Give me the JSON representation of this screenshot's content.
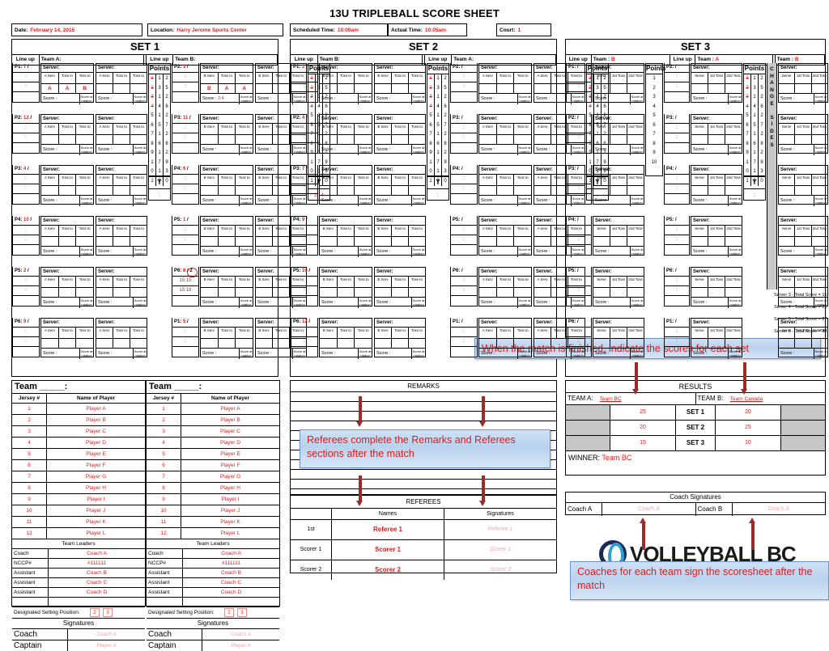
{
  "header": {
    "title": "13U TRIPLEBALL SCORE SHEET",
    "date_label": "Date:",
    "date_value": "February 14, 2015",
    "location_label": "Location:",
    "location_value": "Harry Jerome Sports Center",
    "sched_label": "Scheduled Time:",
    "sched_value": "10:00am",
    "actual_label": "Actual Time:",
    "actual_value": "10:05am",
    "court_label": "Court:",
    "court_value": "1"
  },
  "labels": {
    "lineup": "Line up",
    "server": "Server:",
    "points": "Points",
    "score": "Score  :",
    "score_rot": "Score at rotation",
    "colon": ":",
    "t": "T",
    "slash": "/",
    "team_a_label": "Team A:",
    "team_b_label": "Team B:",
    "team_label": "Team  :",
    "serve_hdr": [
      "A Serv",
      "Toss to",
      "Toss to"
    ],
    "serve_hdr_b": [
      "B Serv",
      "Toss to",
      "Toss to"
    ],
    "serve_hdr_s3": [
      "Serve",
      "1st Toss",
      "2nd Toss"
    ],
    "change_sides": "CHANGE SIDES"
  },
  "points_grid": {
    "col1": [
      "1",
      "2",
      "3",
      "4",
      "5",
      "6",
      "7",
      "8",
      "9",
      "1",
      "0",
      "1"
    ],
    "col2": [
      "1",
      "3",
      "1",
      "4",
      "1",
      "5",
      "1",
      "6",
      "1",
      "7",
      "1",
      "8"
    ],
    "col3": [
      "2",
      "5",
      "2",
      "6",
      "2",
      "7",
      "2",
      "8",
      "2",
      "9",
      "3",
      "0"
    ],
    "struck_col1_rows": [
      0,
      1,
      2,
      3
    ]
  },
  "sets": [
    {
      "title": "SET 1",
      "left": {
        "team_label": "Team A:",
        "serve_hdr": [
          "A Serv",
          "Toss to",
          "Toss to"
        ],
        "lineups": [
          {
            "p": "P1:",
            "num": "7"
          },
          {
            "p": "P2:",
            "num": "12"
          },
          {
            "p": "P3:",
            "num": "4"
          },
          {
            "p": "P4:",
            "num": "10"
          },
          {
            "p": "P5:",
            "num": "2"
          },
          {
            "p": "P6:",
            "num": "9"
          }
        ],
        "serve_marks": [
          "A",
          "A",
          "B"
        ],
        "score_value": ""
      },
      "right": {
        "team_label": "Team B:",
        "serve_hdr": [
          "B Serv",
          "Toss to",
          "Toss to"
        ],
        "lineups": [
          {
            "p": "P2:",
            "num": "3"
          },
          {
            "p": "P3:",
            "num": "11"
          },
          {
            "p": "P4:",
            "num": "6"
          },
          {
            "p": "P5:",
            "num": "1"
          },
          {
            "p": "P6:",
            "num": "8",
            "num2": "2",
            "circled": true,
            "extra": [
              "15:15",
              "15:18"
            ]
          },
          {
            "p": "P1:",
            "num": "5"
          }
        ],
        "serve_marks": [
          "B",
          "A",
          "A"
        ],
        "score_value": "2:4",
        "t_value": "2  :  4"
      }
    },
    {
      "title": "SET 2",
      "left": {
        "team_label": "Team B:",
        "serve_hdr": [
          "B Serv",
          "Toss to",
          "Toss to"
        ],
        "lineups": [
          {
            "p": "P1:",
            "num": "2"
          },
          {
            "p": "P2:",
            "num": "4"
          },
          {
            "p": "P3:",
            "num": "7"
          },
          {
            "p": "P4:",
            "num": "9"
          },
          {
            "p": "P5:",
            "num": "10"
          },
          {
            "p": "P6:",
            "num": "12"
          }
        ],
        "serve_marks": [
          "",
          "",
          ""
        ],
        "score_value": ""
      },
      "right": {
        "team_label": "Team A:",
        "serve_hdr": [
          "A Serv",
          "Toss to",
          "Toss to"
        ],
        "lineups": [
          {
            "p": "P2:",
            "num": ""
          },
          {
            "p": "P3:",
            "num": ""
          },
          {
            "p": "P4:",
            "num": ""
          },
          {
            "p": "P5:",
            "num": ""
          },
          {
            "p": "P6:",
            "num": ""
          },
          {
            "p": "P1:",
            "num": ""
          }
        ],
        "serve_marks": [
          "",
          "",
          ""
        ],
        "score_value": ""
      }
    },
    {
      "title": "SET 3",
      "colA": {
        "team_label": "Team  :",
        "team_letter": "B",
        "lineups": [
          {
            "p": "P1:",
            "num": ""
          },
          {
            "p": "P2:",
            "num": ""
          },
          {
            "p": "P3:",
            "num": ""
          },
          {
            "p": "P4:",
            "num": ""
          },
          {
            "p": "P5:",
            "num": ""
          },
          {
            "p": "P6:",
            "num": ""
          }
        ]
      },
      "colB": {
        "team_label": "Team  :",
        "team_letter": "A",
        "lineups": [
          {
            "p": "P2:",
            "num": ""
          },
          {
            "p": "P3:",
            "num": ""
          },
          {
            "p": "P4:",
            "num": ""
          },
          {
            "p": "P5:",
            "num": ""
          },
          {
            "p": "P6:",
            "num": ""
          },
          {
            "p": "P1:",
            "num": ""
          }
        ]
      },
      "colC": {
        "team_label": "Team  :",
        "team_letter": "B",
        "lineups": []
      },
      "single_points": [
        "1",
        "2",
        "3",
        "4",
        "5",
        "6",
        "7",
        "8",
        "9",
        "10"
      ],
      "totals": [
        "Server 3 - Total Score = 15",
        "Server 4 - Total Score = 21",
        "Server 5 - Total Score = 27",
        "Server 6 - Total Score = 30"
      ]
    }
  ],
  "rosters": [
    {
      "team_title": "Team _____:",
      "hdr_jersey": "Jersey #",
      "hdr_name": "Name of Player",
      "players": [
        {
          "n": "1",
          "name": "Player A"
        },
        {
          "n": "2",
          "name": "Player B"
        },
        {
          "n": "3",
          "name": "Player C"
        },
        {
          "n": "4",
          "name": "Player D"
        },
        {
          "n": "5",
          "name": "Player E"
        },
        {
          "n": "6",
          "name": "Player F"
        },
        {
          "n": "7",
          "name": "Player G"
        },
        {
          "n": "8",
          "name": "Player H"
        },
        {
          "n": "9",
          "name": "Player I"
        },
        {
          "n": "10",
          "name": "Player J"
        },
        {
          "n": "11",
          "name": "Player K"
        },
        {
          "n": "12",
          "name": "Player L"
        }
      ],
      "leaders_title": "Team Leaders",
      "leaders": [
        {
          "role": "Coach",
          "name": "Coach A"
        },
        {
          "role": "NCCP#",
          "name": "#111111"
        },
        {
          "role": "Assistant",
          "name": "Coach B"
        },
        {
          "role": "Assistant",
          "name": "Coach C"
        },
        {
          "role": "Assistant",
          "name": "Coach D"
        },
        {
          "role": "",
          "name": ""
        }
      ],
      "dsp_label": "Designated Setting Position:",
      "dsp_values": [
        "2",
        "3"
      ],
      "sig_title": "Signatures",
      "sigs": [
        {
          "role": "Coach",
          "name": "Coach A"
        },
        {
          "role": "Captain",
          "name": "Player A"
        }
      ]
    },
    {
      "team_title": "Team _____:",
      "hdr_jersey": "Jersey #",
      "hdr_name": "Name of Player",
      "players": [
        {
          "n": "1",
          "name": "Player A"
        },
        {
          "n": "2",
          "name": "Player B"
        },
        {
          "n": "3",
          "name": "Player C"
        },
        {
          "n": "4",
          "name": "Player D"
        },
        {
          "n": "5",
          "name": "Player E"
        },
        {
          "n": "6",
          "name": "Player F"
        },
        {
          "n": "7",
          "name": "Player G"
        },
        {
          "n": "8",
          "name": "Player H"
        },
        {
          "n": "9",
          "name": "Player I"
        },
        {
          "n": "10",
          "name": "Player J"
        },
        {
          "n": "11",
          "name": "Player K"
        },
        {
          "n": "12",
          "name": "Player L"
        }
      ],
      "leaders_title": "Team Leaders",
      "leaders": [
        {
          "role": "Coach",
          "name": "Coach A"
        },
        {
          "role": "NCCP#",
          "name": "#111111"
        },
        {
          "role": "Assistant",
          "name": "Coach B"
        },
        {
          "role": "Assistant",
          "name": "Coach C"
        },
        {
          "role": "Assistant",
          "name": "Coach D"
        },
        {
          "role": "",
          "name": ""
        }
      ],
      "dsp_label": "Designated Setting Position:",
      "dsp_values": [
        "2",
        "3"
      ],
      "sig_title": "Signatures",
      "sigs": [
        {
          "role": "Coach",
          "name": "Coach A"
        },
        {
          "role": "Captain",
          "name": "Player A"
        }
      ]
    }
  ],
  "remarks": {
    "title": "REMARKS",
    "lines": 11
  },
  "referees": {
    "title": "REFEREES",
    "hdr": [
      "",
      "Names",
      "Signatures"
    ],
    "rows": [
      {
        "role": "1st",
        "name": "Referee 1",
        "sig": "Referee 1"
      },
      {
        "role": "Scorer 1",
        "name": "Scorer 1",
        "sig": "Scorer 1"
      },
      {
        "role": "Scorer 2",
        "name": "Scorer 2",
        "sig": "Scorer 2"
      }
    ]
  },
  "results": {
    "title": "RESULTS",
    "team_a_label": "TEAM A:",
    "team_a_name": "Team BC",
    "team_b_label": "TEAM B:",
    "team_b_name": "Team Canada",
    "rows": [
      {
        "set": "SET 1",
        "a": "25",
        "b": "20"
      },
      {
        "set": "SET 2",
        "a": "20",
        "b": "25"
      },
      {
        "set": "SET 3",
        "a": "15",
        "b": "10"
      }
    ],
    "winner_label": "WINNER:",
    "winner_value": "Team BC"
  },
  "coach_signatures": {
    "title": "Coach Signatures",
    "rows": [
      {
        "label": "Coach A",
        "sig": "Coach A"
      },
      {
        "label": "Coach B",
        "sig": "Coach A"
      }
    ]
  },
  "callouts": [
    {
      "id": "scores-callout",
      "text": "When the match is finished, indicate the scores for each set"
    },
    {
      "id": "remarks-callout",
      "text": "Referees complete the Remarks and Referees sections after the match"
    },
    {
      "id": "coaches-callout",
      "text": "Coaches for each team sign the scoresheet after the match"
    }
  ],
  "logo": {
    "text": "VOLLEYBALL BC"
  }
}
